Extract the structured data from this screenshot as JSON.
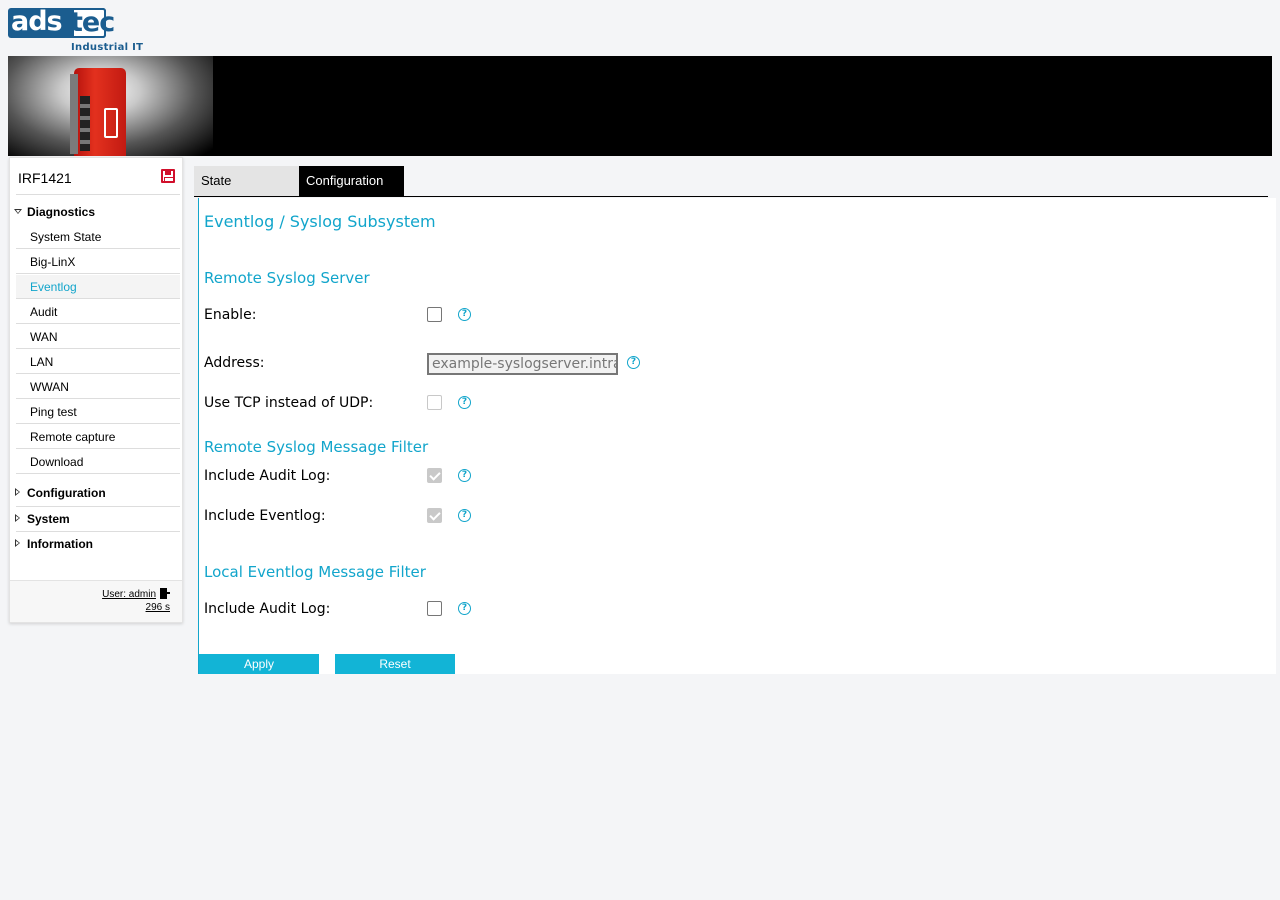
{
  "logo": {
    "brand": "ads",
    "brand_suffix": "tec",
    "tagline": "Industrial IT"
  },
  "sidebar": {
    "device_name": "IRF1421",
    "groups": [
      {
        "label": "Diagnostics",
        "expanded": true
      },
      {
        "label": "Configuration",
        "expanded": false
      },
      {
        "label": "System",
        "expanded": false
      },
      {
        "label": "Information",
        "expanded": false
      }
    ],
    "diagnostics_items": [
      {
        "label": "System State"
      },
      {
        "label": "Big-LinX"
      },
      {
        "label": "Eventlog",
        "active": true
      },
      {
        "label": "Audit"
      },
      {
        "label": "WAN"
      },
      {
        "label": "LAN"
      },
      {
        "label": "WWAN"
      },
      {
        "label": "Ping test"
      },
      {
        "label": "Remote capture"
      },
      {
        "label": "Download"
      }
    ],
    "user_label": "User: admin",
    "session_timer": "296 s"
  },
  "tabs": [
    {
      "label": "State",
      "active": false
    },
    {
      "label": "Configuration",
      "active": true
    }
  ],
  "main": {
    "title": "Eventlog / Syslog Subsystem",
    "remote_server": {
      "heading": "Remote Syslog Server",
      "enable_label": "Enable:",
      "enable_checked": false,
      "address_label": "Address:",
      "address_placeholder": "example-syslogserver.intranet",
      "tcp_label": "Use TCP instead of UDP:",
      "tcp_checked": false
    },
    "remote_filter": {
      "heading": "Remote Syslog Message Filter",
      "audit_label": "Include Audit Log:",
      "audit_checked": true,
      "eventlog_label": "Include Eventlog:",
      "eventlog_checked": true
    },
    "local_filter": {
      "heading": "Local Eventlog Message Filter",
      "audit_label": "Include Audit Log:",
      "audit_checked": false
    },
    "help_glyph": "?",
    "apply_label": "Apply",
    "reset_label": "Reset"
  },
  "colors": {
    "accent": "#12a5cb",
    "button": "#12b4d6",
    "brand_blue": "#1b5d8f",
    "save_icon_red": "#d10f2b"
  }
}
